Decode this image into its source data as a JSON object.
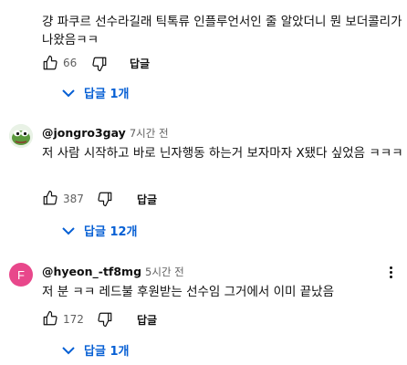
{
  "comments": [
    {
      "author_partial": "",
      "text_line1": "걍 파쿠르 선수라길래 틱톡류 인플루언서인 줄 알았더니 뭔 보더콜리가",
      "text_line2": "나왔음ㅋㅋ",
      "likes": "66",
      "reply_label": "답글",
      "replies_label": "답글 1개"
    },
    {
      "author": "@jongro3gay",
      "time": "7시간 전",
      "text": "저 사람 시작하고 바로 닌자행동 하는거 보자마자 X됐다 싶었음 ㅋㅋㅋ",
      "likes": "387",
      "reply_label": "답글",
      "replies_label": "답글 12개"
    },
    {
      "author": "@hyeon_-tf8mg",
      "time": "5시간 전",
      "avatar_letter": "F",
      "avatar_color": "#e8478b",
      "text": "저 분 ㅋㅋ 레드불 후원받는 선수임 그거에서 이미 끝났음",
      "likes": "172",
      "reply_label": "답글",
      "replies_label": "답글 1개"
    }
  ],
  "colors": {
    "link": "#065fd4",
    "secondary_text": "#606060"
  },
  "icons": [
    "thumbs-up-icon",
    "thumbs-down-icon",
    "chevron-down-icon",
    "more-vert-icon",
    "pepe-avatar-icon"
  ]
}
